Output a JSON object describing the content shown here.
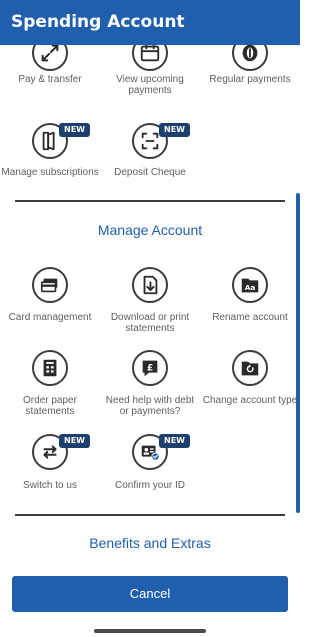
{
  "header": {
    "title": "Spending Account"
  },
  "badge_text": "NEW",
  "quick_actions": [
    {
      "label": "Pay & transfer",
      "icon": "pay-transfer-icon"
    },
    {
      "label": "View upcoming payments",
      "icon": "calendar-icon"
    },
    {
      "label": "Regular payments",
      "icon": "regular-payments-icon"
    },
    {
      "label": "Manage subscriptions",
      "icon": "subscriptions-icon",
      "new": true
    },
    {
      "label": "Deposit Cheque",
      "icon": "cheque-scan-icon",
      "new": true
    }
  ],
  "manage_section": {
    "title": "Manage Account"
  },
  "manage_actions": [
    {
      "label": "Card management",
      "icon": "card-icon"
    },
    {
      "label": "Download or print statements",
      "icon": "download-icon"
    },
    {
      "label": "Rename account",
      "icon": "rename-icon"
    },
    {
      "label": "Order paper statements",
      "icon": "statement-icon"
    },
    {
      "label": "Need help with debt or payments?",
      "icon": "debt-help-icon"
    },
    {
      "label": "Change account type",
      "icon": "change-type-icon"
    },
    {
      "label": "Switch to us",
      "icon": "switch-icon",
      "new": true
    },
    {
      "label": "Confirm your ID",
      "icon": "id-check-icon",
      "new": true
    }
  ],
  "benefits_section": {
    "title": "Benefits and Extras"
  },
  "footer": {
    "cancel_label": "Cancel"
  },
  "colors": {
    "primary": "#1f5fad",
    "badge": "#1c3f6e",
    "icon_stroke": "#3c3c3c",
    "label_text": "#5f5f5f"
  }
}
